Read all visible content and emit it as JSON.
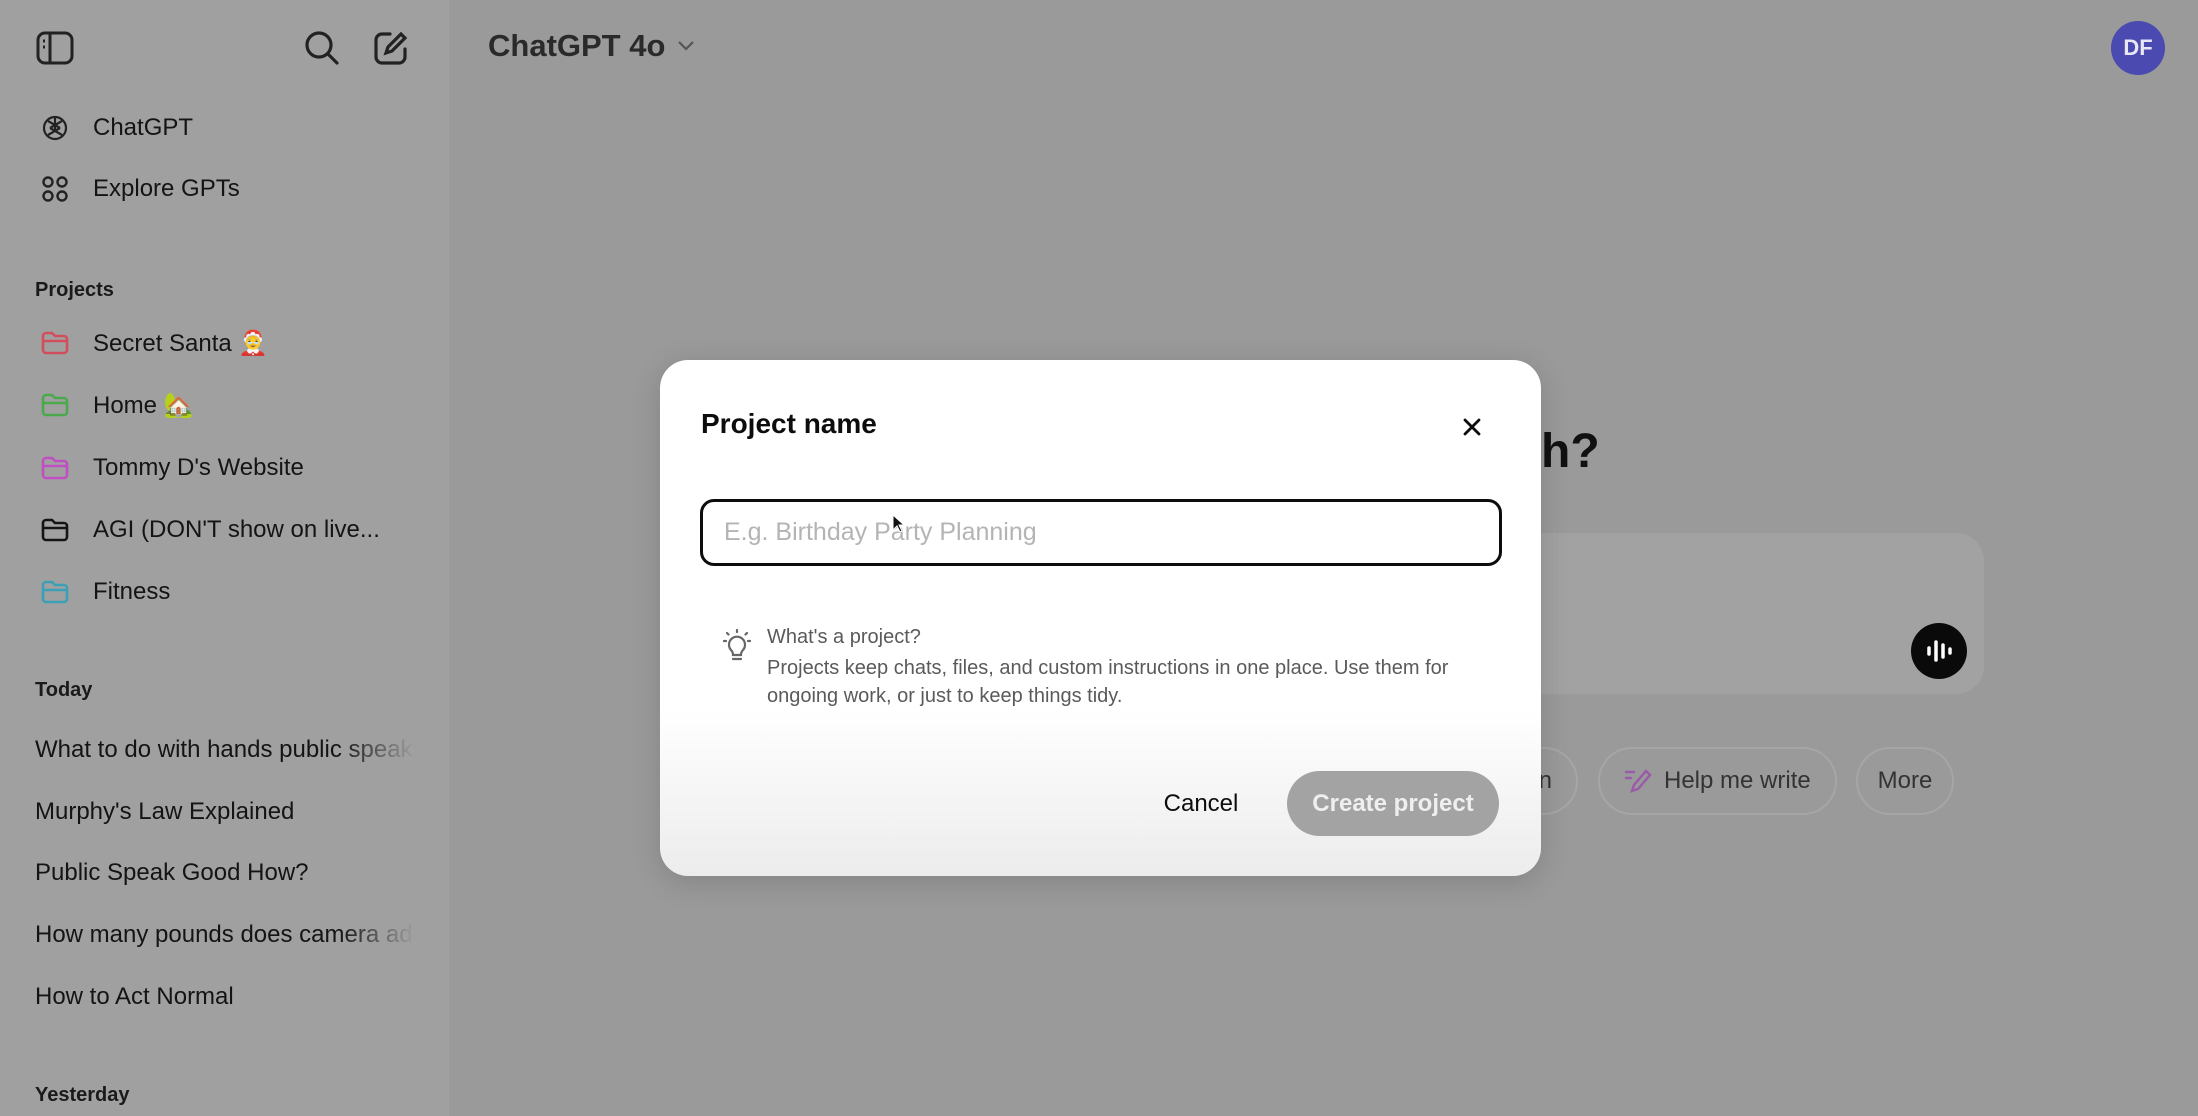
{
  "header": {
    "model_title": "ChatGPT 4o",
    "avatar_initials": "DF"
  },
  "sidebar": {
    "nav": [
      {
        "label": "ChatGPT",
        "icon": "openai-logo-icon"
      },
      {
        "label": "Explore GPTs",
        "icon": "grid-icon"
      }
    ],
    "projects_header": "Projects",
    "projects": [
      {
        "label": "Secret Santa 🤶",
        "color": "#d24e5c"
      },
      {
        "label": "Home 🏡",
        "color": "#4ca84c"
      },
      {
        "label": "Tommy D's Website",
        "color": "#c04fc4"
      },
      {
        "label": "AGI (DON'T show on live...",
        "color": "#141414"
      },
      {
        "label": "Fitness",
        "color": "#3b9fb6"
      }
    ],
    "today_header": "Today",
    "today": [
      "What to do with hands public speaking",
      "Murphy's Law Explained",
      "Public Speak Good How?",
      "How many pounds does camera add",
      "How to Act Normal"
    ],
    "yesterday_header": "Yesterday"
  },
  "main": {
    "heading_fragment": "h?",
    "pills": [
      {
        "label": "n"
      },
      {
        "label": "Help me write",
        "icon": "pen-icon"
      },
      {
        "label": "More"
      }
    ]
  },
  "modal": {
    "title": "Project name",
    "input_placeholder": "E.g. Birthday Party Planning",
    "info_title": "What's a project?",
    "info_desc": "Projects keep chats, files, and custom instructions in one place. Use them for ongoing work, or just to keep things tidy.",
    "cancel_label": "Cancel",
    "create_label": "Create project"
  }
}
